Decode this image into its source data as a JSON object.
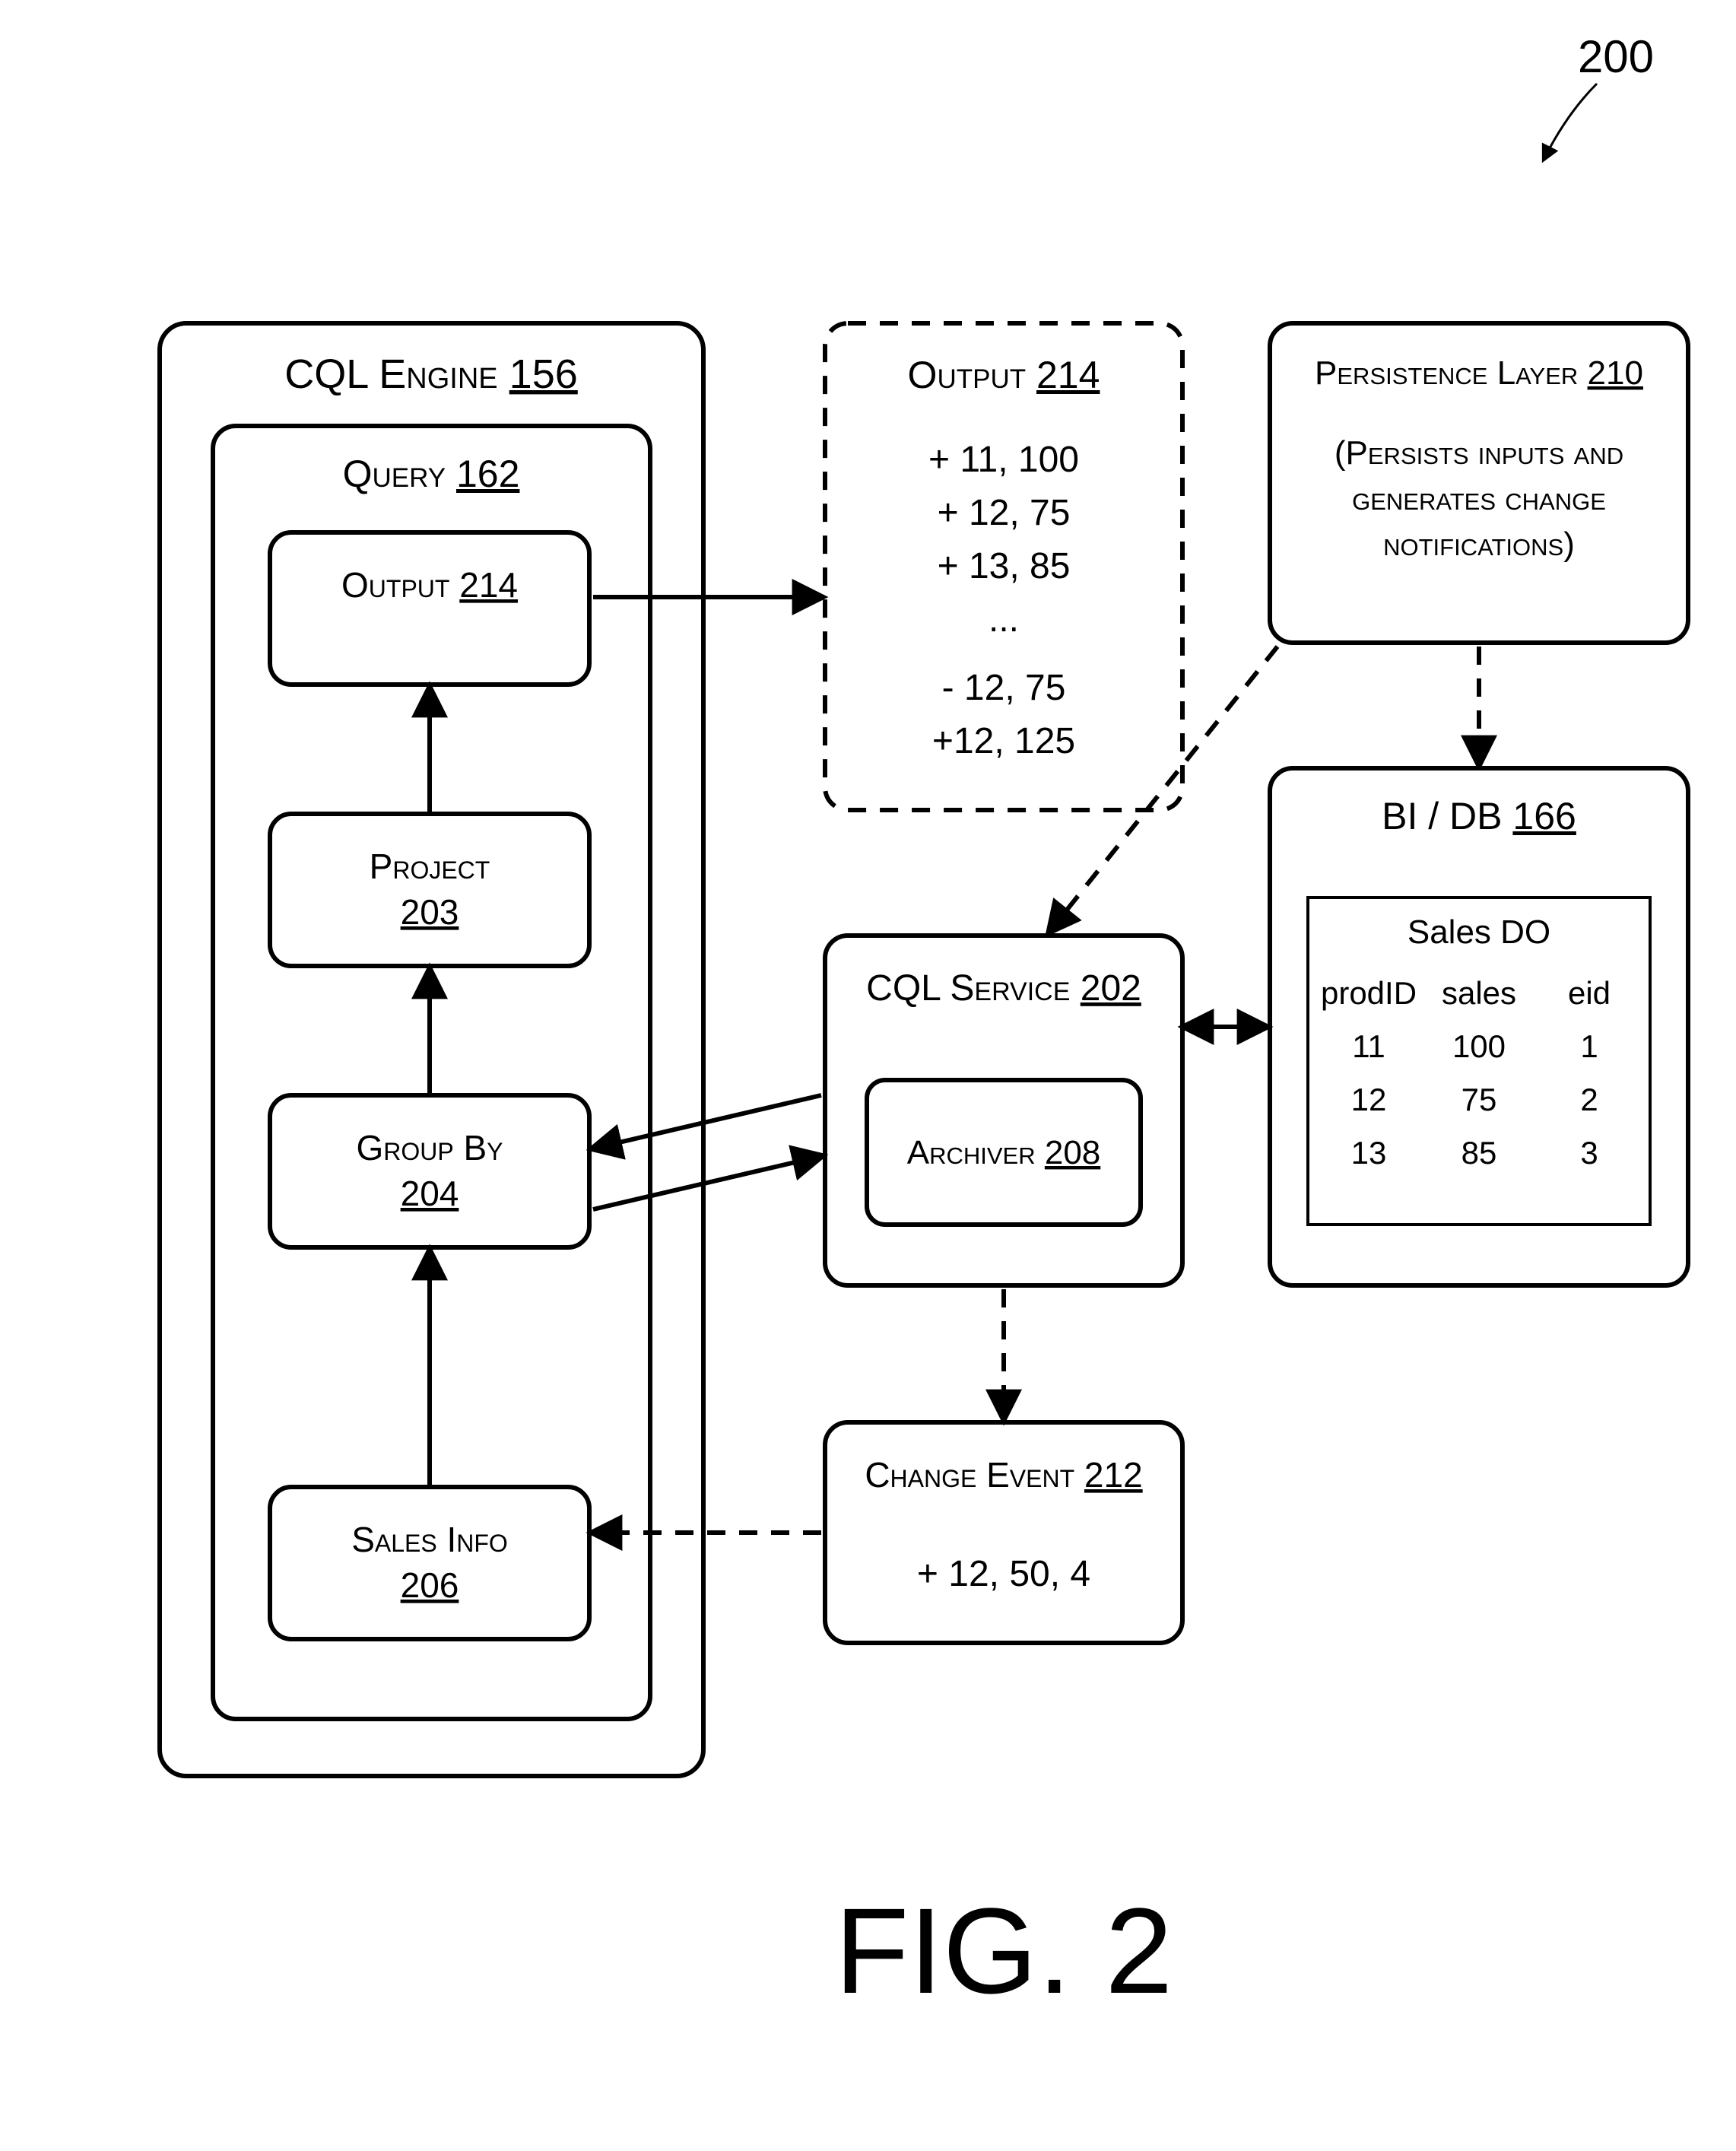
{
  "figure_ref": "200",
  "figure_label": "FIG. 2",
  "cql_engine": {
    "title": "CQL Engine",
    "ref": "156"
  },
  "query": {
    "title": "Query",
    "ref": "162"
  },
  "query_ops": {
    "output": {
      "title": "Output",
      "ref": "214"
    },
    "project": {
      "title": "Project",
      "ref": "203"
    },
    "groupby": {
      "title": "Group By",
      "ref": "204"
    },
    "salesinfo": {
      "title": "Sales Info",
      "ref": "206"
    }
  },
  "output_block": {
    "title": "Output",
    "ref": "214",
    "lines": [
      "+ 11, 100",
      "+ 12, 75",
      "+ 13, 85",
      "...",
      "- 12, 75",
      "+12, 125"
    ]
  },
  "cql_service": {
    "title": "CQL Service",
    "ref": "202"
  },
  "archiver": {
    "title": "Archiver",
    "ref": "208"
  },
  "persistence": {
    "title": "Persistence Layer",
    "ref": "210",
    "caption1": "(Persists inputs and",
    "caption2": "generates change",
    "caption3": "notifications)"
  },
  "bi_db": {
    "title": "BI / DB",
    "ref": "166",
    "table_title": "Sales DO",
    "headers": [
      "prodID",
      "sales",
      "eid"
    ],
    "rows": [
      [
        "11",
        "100",
        "1"
      ],
      [
        "12",
        "75",
        "2"
      ],
      [
        "13",
        "85",
        "3"
      ]
    ]
  },
  "change_event": {
    "title": "Change Event",
    "ref": "212",
    "payload": "+ 12, 50, 4"
  }
}
